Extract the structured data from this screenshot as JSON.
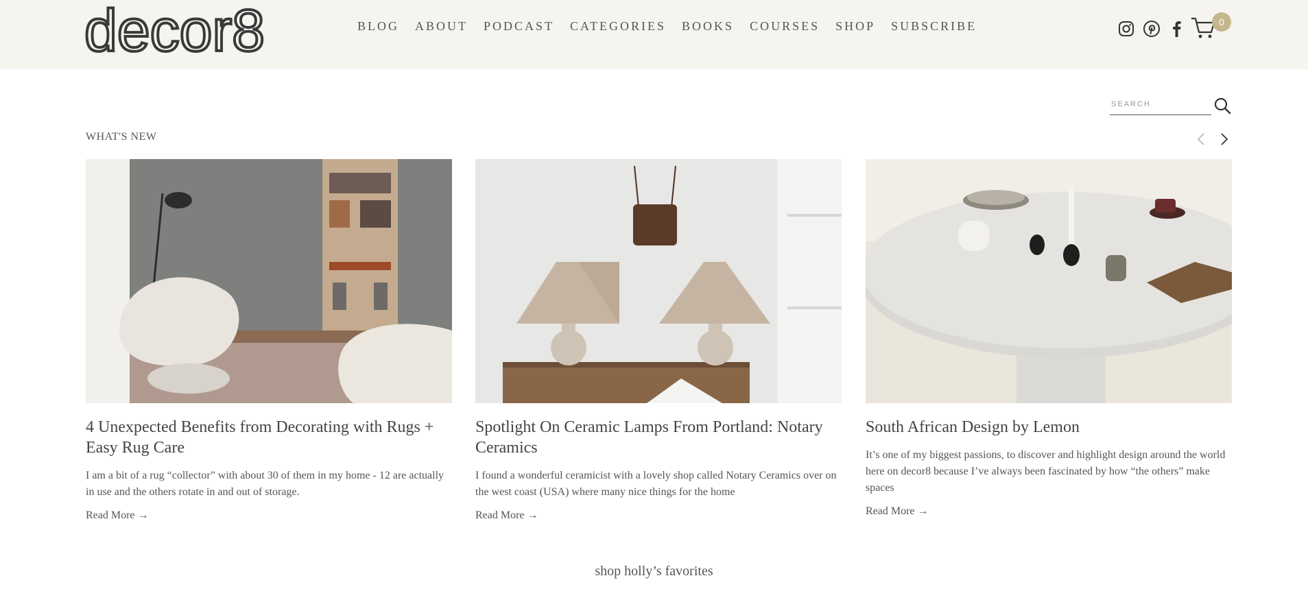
{
  "brand": {
    "logo_text": "decor8"
  },
  "nav": {
    "items": [
      "BLOG",
      "ABOUT",
      "PODCAST",
      "CATEGORIES",
      "BOOKS",
      "COURSES",
      "SHOP",
      "SUBSCRIBE"
    ]
  },
  "social": {
    "icons": [
      "instagram-icon",
      "pinterest-icon",
      "facebook-icon"
    ]
  },
  "cart": {
    "count": "0"
  },
  "search": {
    "placeholder": "SEARCH"
  },
  "section": {
    "title": "WHAT'S NEW"
  },
  "posts": [
    {
      "title": "4 Unexpected Benefits from Decorating with Rugs + Easy Rug Care",
      "excerpt": "I am a bit of a rug “collector” with about 30 of them in my home - 12 are actually in use and the others rotate in and out of storage.",
      "read_more": "Read More →"
    },
    {
      "title": "Spotlight On Ceramic Lamps From Portland: Notary Ceramics",
      "excerpt": "I found a wonderful ceramicist with a lovely shop called Notary Ceramics over on the west coast (USA) where many nice things for the home",
      "read_more": "Read More →"
    },
    {
      "title": "South African Design by Lemon",
      "excerpt": "It’s one of my biggest passions, to discover and highlight design around the world here on decor8 because I’ve always been fascinated by how “the others” make spaces",
      "read_more": "Read More →"
    }
  ],
  "footer_teaser": {
    "label": "shop holly’s favorites"
  },
  "colors": {
    "header_bg": "#f5f4ef",
    "accent_badge": "#c5b78c",
    "text": "#444444"
  }
}
